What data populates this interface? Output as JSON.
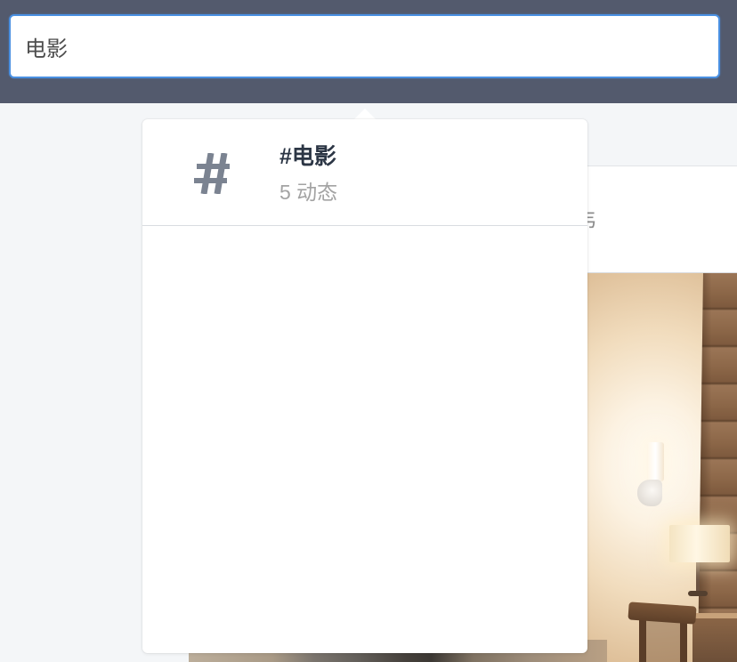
{
  "header": {
    "search": {
      "value": "电影"
    }
  },
  "dropdown": {
    "results": [
      {
        "icon": "hash-icon",
        "title": "#电影",
        "subtitle": "5 动态"
      }
    ]
  },
  "feed_card": {
    "partial_text": "韦"
  },
  "colors": {
    "header_bg": "#535a6d",
    "page_bg": "#f4f6f8",
    "input_border": "#4a90e2",
    "title": "#2c3645",
    "subtitle": "#a3a3a3",
    "icon": "#7b8391"
  }
}
